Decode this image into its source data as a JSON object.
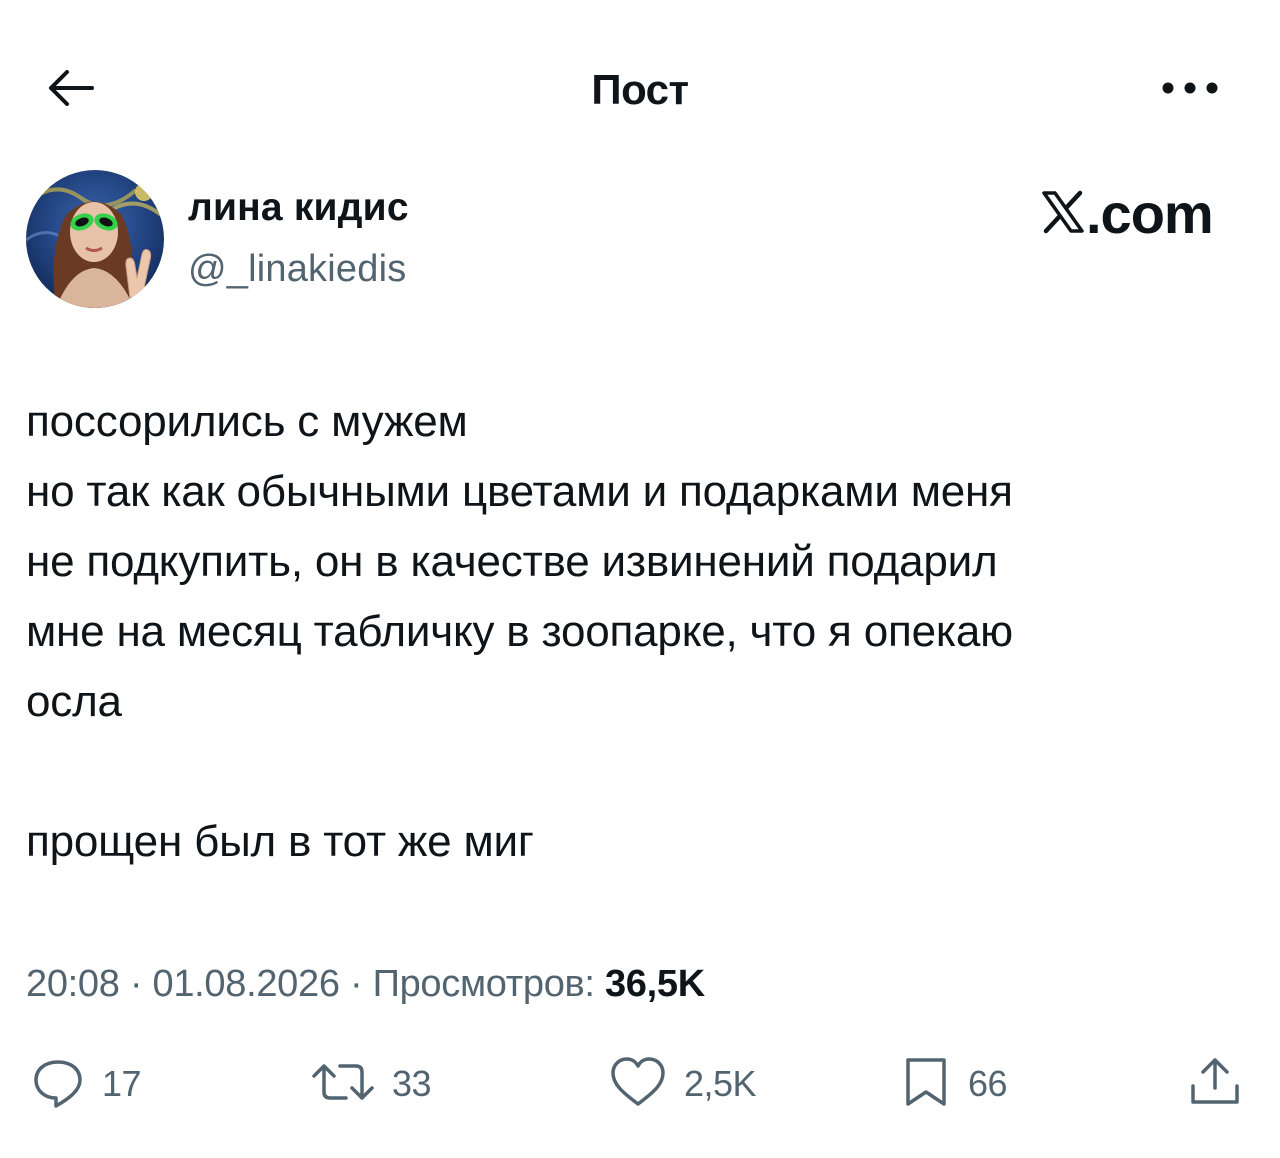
{
  "header": {
    "title": "Пост",
    "back_icon": "arrow-left-icon",
    "more_icon": "more-horizontal-icon"
  },
  "author": {
    "name": "лина кидис",
    "handle": "@_linakiedis",
    "avatar": "avatar-photo"
  },
  "brand": {
    "logo": "x-logo",
    "text": ".com"
  },
  "post": {
    "lines": [
      "поссорились с мужем",
      "но так как обычными цветами и подарками меня",
      "не подкупить, он в качестве извинений подарил",
      "мне на месяц табличку в зоопарке, что я опекаю",
      "осла",
      "прощен был в тот же миг"
    ]
  },
  "meta": {
    "time": "20:08",
    "separator": "·",
    "date": "01.08.2026",
    "views_label": "Просмотров:",
    "views_count": "36,5K"
  },
  "actions": {
    "reply": {
      "count": "17",
      "icon": "reply-icon"
    },
    "repost": {
      "count": "33",
      "icon": "repost-icon"
    },
    "like": {
      "count": "2,5K",
      "icon": "heart-icon"
    },
    "bookmark": {
      "count": "66",
      "icon": "bookmark-icon"
    },
    "share": {
      "icon": "share-icon"
    }
  },
  "colors": {
    "text": "#0f1419",
    "secondary": "#536471",
    "background": "#ffffff"
  }
}
